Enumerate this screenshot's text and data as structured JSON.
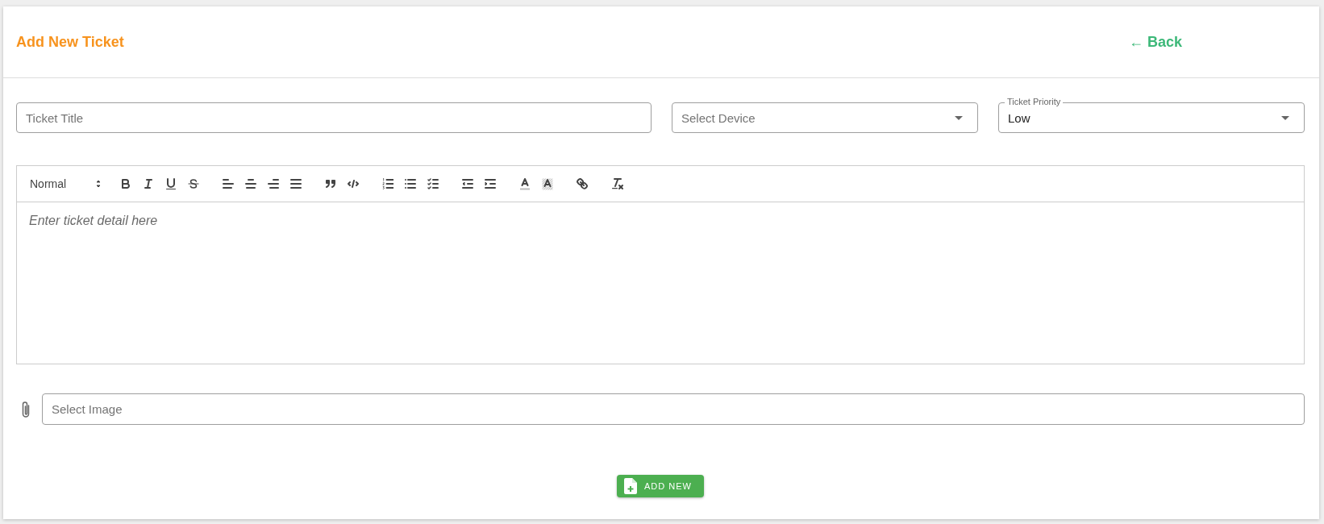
{
  "header": {
    "title": "Add New Ticket",
    "back_link": "← Back"
  },
  "fields": [
    {
      "kind": "text",
      "placeholder": "Ticket Title"
    },
    {
      "kind": "select",
      "placeholder": "Select Device"
    },
    {
      "kind": "select",
      "label": "Ticket Priority",
      "value": "Low"
    }
  ],
  "editor": {
    "format_picker": "Normal",
    "placeholder": "Enter ticket detail here"
  },
  "attachment": {
    "placeholder": "Select Image"
  },
  "submit_button": "ADD NEW"
}
